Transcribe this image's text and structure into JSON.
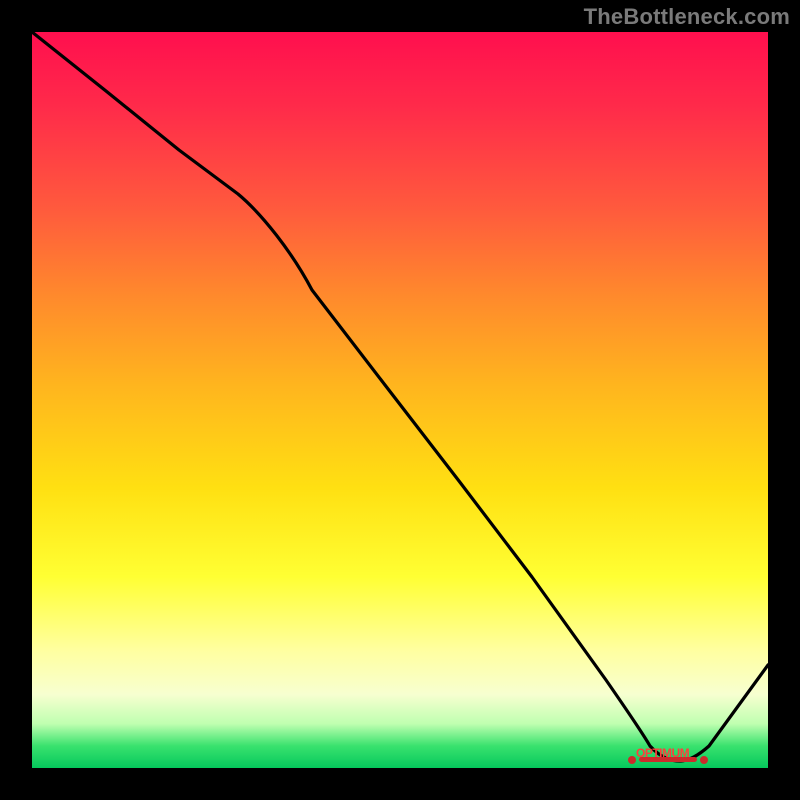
{
  "watermark": "TheBottleneck.com",
  "chart_data": {
    "type": "line",
    "title": "",
    "xlabel": "",
    "ylabel": "",
    "x": [
      0.0,
      0.1,
      0.2,
      0.28,
      0.38,
      0.48,
      0.58,
      0.68,
      0.78,
      0.84,
      0.88,
      0.92,
      1.0
    ],
    "y": [
      1.0,
      0.92,
      0.84,
      0.78,
      0.65,
      0.52,
      0.39,
      0.26,
      0.12,
      0.03,
      0.01,
      0.03,
      0.14
    ],
    "optimum_x": 0.88,
    "optimum_y": 0.01,
    "xlim": [
      0,
      1
    ],
    "ylim": [
      0,
      1
    ],
    "optimum_label": "OPTIMUM"
  },
  "optimum_label_text": "OPTIMUM",
  "colors": {
    "line": "#000000",
    "marker": "#cc2b2b",
    "label": "#ff3d3d"
  }
}
